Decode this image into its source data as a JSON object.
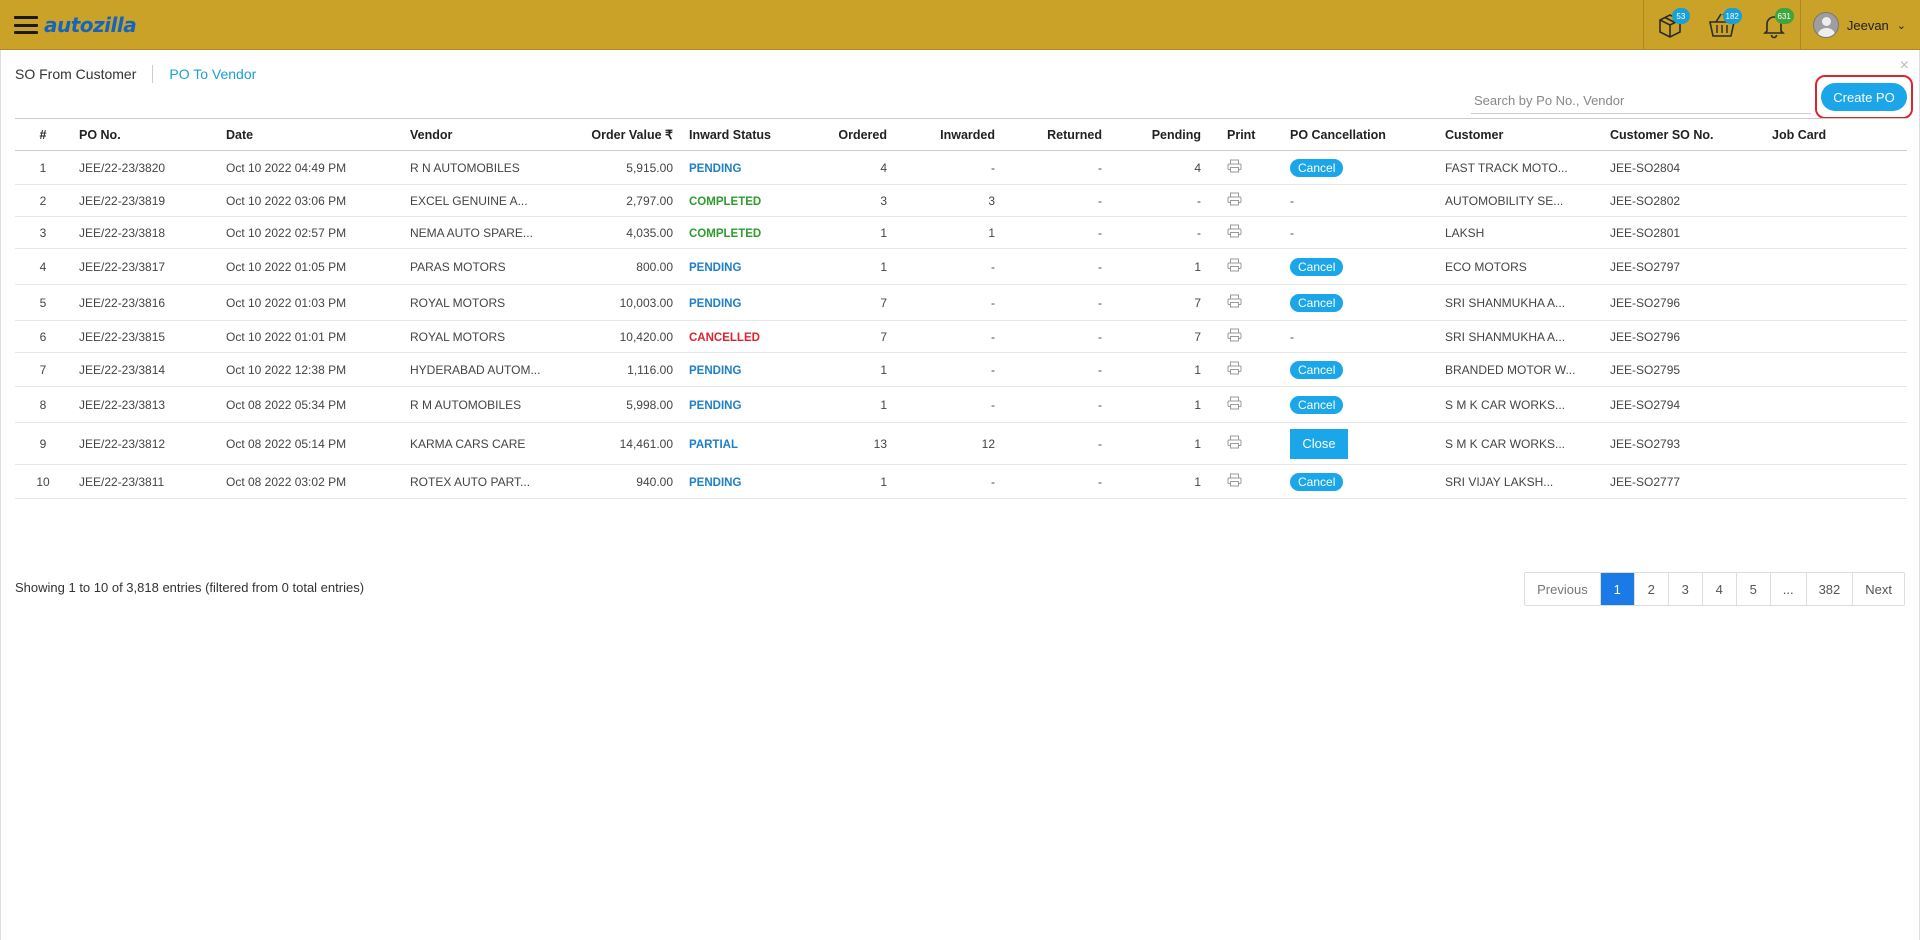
{
  "header": {
    "logo_text": "autozilla",
    "icons": [
      {
        "name": "package-icon",
        "badge": "53",
        "badge_color": "#1a9fd6"
      },
      {
        "name": "basket-icon",
        "badge": "182",
        "badge_color": "#1a9fd6"
      },
      {
        "name": "bell-icon",
        "badge": "631",
        "badge_color": "#3fa53f"
      }
    ],
    "user_name": "Jeevan",
    "user_caret": "⌄"
  },
  "tabs": {
    "so_from_customer": "SO From Customer",
    "po_to_vendor": "PO To Vendor"
  },
  "close_glyph": "×",
  "search": {
    "placeholder": "Search by Po No., Vendor",
    "value": ""
  },
  "create_button": "Create PO",
  "table": {
    "columns": {
      "num": "#",
      "po_no": "PO No.",
      "date": "Date",
      "vendor": "Vendor",
      "order_value": "Order Value ₹",
      "inward_status": "Inward Status",
      "ordered": "Ordered",
      "inwarded": "Inwarded",
      "returned": "Returned",
      "pending": "Pending",
      "print": "Print",
      "po_cancellation": "PO Cancellation",
      "customer": "Customer",
      "customer_so": "Customer SO No.",
      "job_card": "Job Card"
    },
    "rows": [
      {
        "num": "1",
        "po_no": "JEE/22-23/3820",
        "date": "Oct 10 2022 04:49 PM",
        "vendor": "R N AUTOMOBILES",
        "order_value": "5,915.00",
        "status": "PENDING",
        "status_class": "pending",
        "ordered": "4",
        "inwarded": "-",
        "returned": "-",
        "pending": "4",
        "action": "Cancel",
        "customer": "FAST TRACK MOTO...",
        "customer_so": "JEE-SO2804",
        "job_card": ""
      },
      {
        "num": "2",
        "po_no": "JEE/22-23/3819",
        "date": "Oct 10 2022 03:06 PM",
        "vendor": "EXCEL GENUINE A...",
        "order_value": "2,797.00",
        "status": "COMPLETED",
        "status_class": "completed",
        "ordered": "3",
        "inwarded": "3",
        "returned": "-",
        "pending": "-",
        "action": "-",
        "customer": "AUTOMOBILITY SE...",
        "customer_so": "JEE-SO2802",
        "job_card": ""
      },
      {
        "num": "3",
        "po_no": "JEE/22-23/3818",
        "date": "Oct 10 2022 02:57 PM",
        "vendor": "NEMA AUTO SPARE...",
        "order_value": "4,035.00",
        "status": "COMPLETED",
        "status_class": "completed",
        "ordered": "1",
        "inwarded": "1",
        "returned": "-",
        "pending": "-",
        "action": "-",
        "customer": "LAKSH",
        "customer_so": "JEE-SO2801",
        "job_card": ""
      },
      {
        "num": "4",
        "po_no": "JEE/22-23/3817",
        "date": "Oct 10 2022 01:05 PM",
        "vendor": "PARAS MOTORS",
        "order_value": "800.00",
        "status": "PENDING",
        "status_class": "pending",
        "ordered": "1",
        "inwarded": "-",
        "returned": "-",
        "pending": "1",
        "action": "Cancel",
        "customer": "ECO MOTORS",
        "customer_so": "JEE-SO2797",
        "job_card": ""
      },
      {
        "num": "5",
        "po_no": "JEE/22-23/3816",
        "date": "Oct 10 2022 01:03 PM",
        "vendor": "ROYAL MOTORS",
        "order_value": "10,003.00",
        "status": "PENDING",
        "status_class": "pending",
        "ordered": "7",
        "inwarded": "-",
        "returned": "-",
        "pending": "7",
        "action": "Cancel",
        "customer": "SRI SHANMUKHA A...",
        "customer_so": "JEE-SO2796",
        "job_card": ""
      },
      {
        "num": "6",
        "po_no": "JEE/22-23/3815",
        "date": "Oct 10 2022 01:01 PM",
        "vendor": "ROYAL MOTORS",
        "order_value": "10,420.00",
        "status": "CANCELLED",
        "status_class": "cancelled",
        "ordered": "7",
        "inwarded": "-",
        "returned": "-",
        "pending": "7",
        "action": "-",
        "customer": "SRI SHANMUKHA A...",
        "customer_so": "JEE-SO2796",
        "job_card": ""
      },
      {
        "num": "7",
        "po_no": "JEE/22-23/3814",
        "date": "Oct 10 2022 12:38 PM",
        "vendor": "HYDERABAD AUTOM...",
        "order_value": "1,116.00",
        "status": "PENDING",
        "status_class": "pending",
        "ordered": "1",
        "inwarded": "-",
        "returned": "-",
        "pending": "1",
        "action": "Cancel",
        "customer": "BRANDED MOTOR W...",
        "customer_so": "JEE-SO2795",
        "job_card": ""
      },
      {
        "num": "8",
        "po_no": "JEE/22-23/3813",
        "date": "Oct 08 2022 05:34 PM",
        "vendor": "R M AUTOMOBILES",
        "order_value": "5,998.00",
        "status": "PENDING",
        "status_class": "pending",
        "ordered": "1",
        "inwarded": "-",
        "returned": "-",
        "pending": "1",
        "action": "Cancel",
        "customer": "S M K CAR WORKS...",
        "customer_so": "JEE-SO2794",
        "job_card": ""
      },
      {
        "num": "9",
        "po_no": "JEE/22-23/3812",
        "date": "Oct 08 2022 05:14 PM",
        "vendor": "KARMA CARS CARE",
        "order_value": "14,461.00",
        "status": "PARTIAL",
        "status_class": "partial",
        "ordered": "13",
        "inwarded": "12",
        "returned": "-",
        "pending": "1",
        "action": "Close",
        "customer": "S M K CAR WORKS...",
        "customer_so": "JEE-SO2793",
        "job_card": ""
      },
      {
        "num": "10",
        "po_no": "JEE/22-23/3811",
        "date": "Oct 08 2022 03:02 PM",
        "vendor": "ROTEX AUTO PART...",
        "order_value": "940.00",
        "status": "PENDING",
        "status_class": "pending",
        "ordered": "1",
        "inwarded": "-",
        "returned": "-",
        "pending": "1",
        "action": "Cancel",
        "customer": "SRI VIJAY LAKSH...",
        "customer_so": "JEE-SO2777",
        "job_card": ""
      }
    ]
  },
  "footer": {
    "info": "Showing 1 to 10 of 3,818 entries (filtered from 0 total entries)",
    "pagination": [
      "Previous",
      "1",
      "2",
      "3",
      "4",
      "5",
      "...",
      "382",
      "Next"
    ],
    "active_page": "1"
  },
  "colors": {
    "topbar": "#c9a227",
    "accent": "#1aa6e8",
    "status_pending": "#1e7fc8",
    "status_completed": "#2e9c2e",
    "status_cancelled": "#d9262c",
    "highlight_box": "#d9262c"
  }
}
